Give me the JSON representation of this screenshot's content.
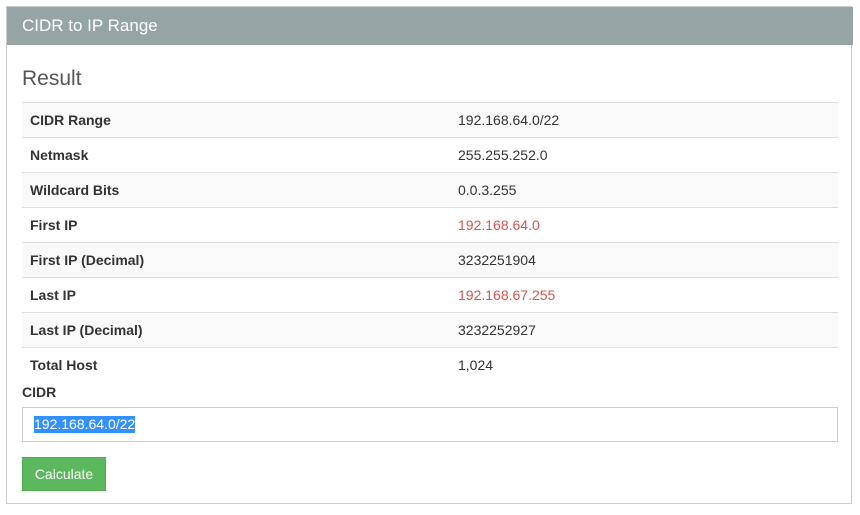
{
  "panel": {
    "title": "CIDR to IP Range"
  },
  "result": {
    "title": "Result",
    "rows": [
      {
        "label": "CIDR Range",
        "value": "192.168.64.0/22"
      },
      {
        "label": "Netmask",
        "value": "255.255.252.0"
      },
      {
        "label": "Wildcard Bits",
        "value": "0.0.3.255"
      },
      {
        "label": "First IP",
        "value": "192.168.64.0"
      },
      {
        "label": "First IP (Decimal)",
        "value": "3232251904"
      },
      {
        "label": "Last IP",
        "value": "192.168.67.255"
      },
      {
        "label": "Last IP (Decimal)",
        "value": "3232252927"
      },
      {
        "label": "Total Host",
        "value": "1,024"
      }
    ]
  },
  "form": {
    "cidr_label": "CIDR",
    "cidr_value": "192.168.64.0/22",
    "calculate_label": "Calculate"
  },
  "colors": {
    "header_bg": "#95a5a6",
    "highlight_text": "#d9534f",
    "button_bg": "#5cb85c",
    "selection_bg": "#3390ff"
  }
}
